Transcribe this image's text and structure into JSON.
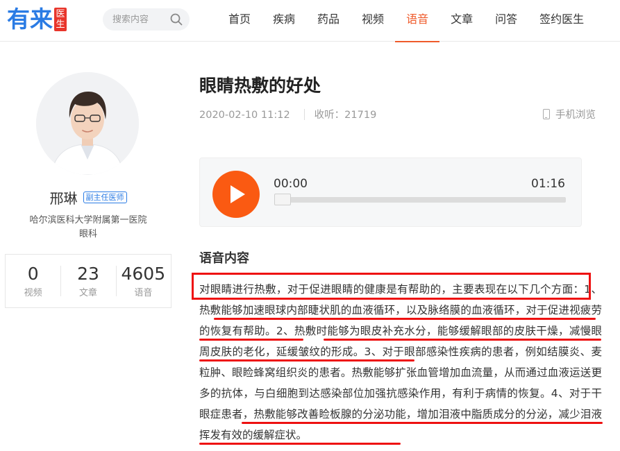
{
  "header": {
    "logo_text": "有来",
    "logo_badge": "医生",
    "search_placeholder": "搜索内容",
    "nav": [
      {
        "label": "首页",
        "active": false
      },
      {
        "label": "疾病",
        "active": false
      },
      {
        "label": "药品",
        "active": false
      },
      {
        "label": "视频",
        "active": false
      },
      {
        "label": "语音",
        "active": true
      },
      {
        "label": "文章",
        "active": false
      },
      {
        "label": "问答",
        "active": false
      },
      {
        "label": "签约医生",
        "active": false
      }
    ]
  },
  "doctor": {
    "name": "邢琳",
    "title": "副主任医师",
    "hospital": "哈尔滨医科大学附属第一医院",
    "department": "眼科",
    "stats": [
      {
        "value": "0",
        "label": "视频"
      },
      {
        "value": "23",
        "label": "文章"
      },
      {
        "value": "4605",
        "label": "语音"
      }
    ]
  },
  "article": {
    "title": "眼睛热敷的好处",
    "date": "2020-02-10 11:12",
    "listens": "收听：21719",
    "mobile_view": "手机浏览"
  },
  "player": {
    "current_time": "00:00",
    "total_time": "01:16",
    "progress": 0
  },
  "content": {
    "section_title": "语音内容",
    "text": "对眼睛进行热敷，对于促进眼睛的健康是有帮助的，主要表现在以下几个方面：1、热敷能够加速眼球内部睫状肌的血液循环，以及脉络膜的血液循环，对于促进视疲劳的恢复有帮助。2、热敷时能够为眼皮补充水分，能够缓解眼部的皮肤干燥，减慢眼周皮肤的老化，延缓皱纹的形成。3、对于眼部感染性疾病的患者，例如结膜炎、麦粒肿、眼睑蜂窝组织炎的患者。热敷能够扩张血管增加血流量，从而通过血液运送更多的抗体，与白细胞到达感染部位加强抗感染作用，有利于病情的恢复。4、对于干眼症患者，热敷能够改善睑板腺的分泌功能，增加泪液中脂质成分的分泌，减少泪液挥发有效的缓解症状。"
  },
  "colors": {
    "accent": "#ef5a2a",
    "play_button": "#fa5a12",
    "brand_blue": "#2a7be4",
    "annotation_red": "#ee1111"
  }
}
